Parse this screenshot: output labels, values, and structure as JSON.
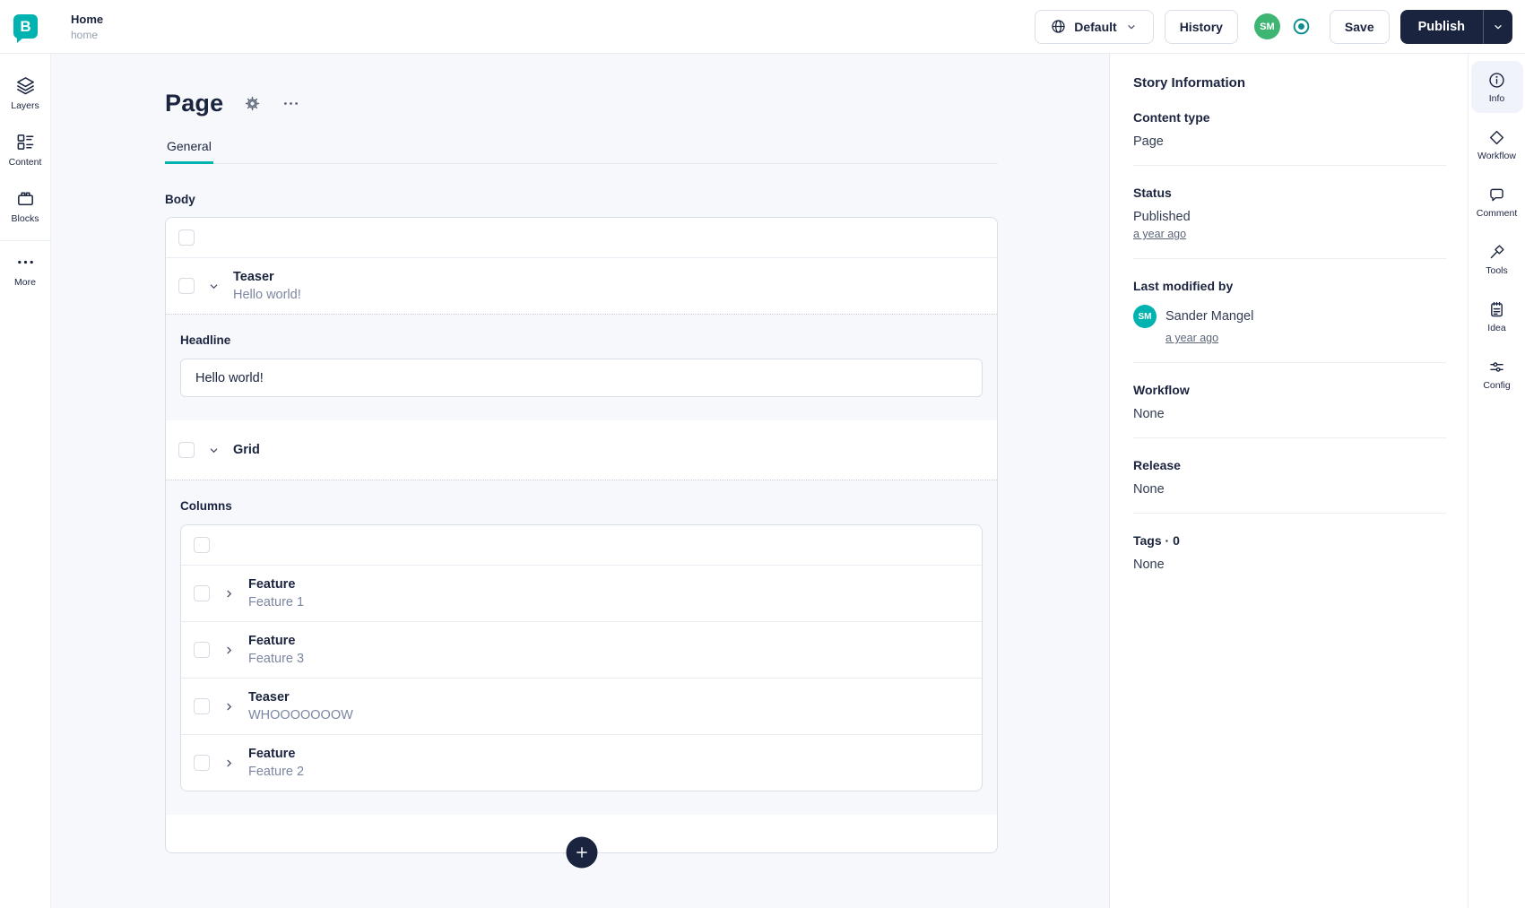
{
  "colors": {
    "brand": "#00b3b0",
    "navy": "#1b243f",
    "avatar_green": "#3fb573",
    "preview_teal": "#0b8f8c"
  },
  "app": {
    "logo_letter": "B"
  },
  "topbar": {
    "breadcrumb": {
      "title": "Home",
      "slug": "home"
    },
    "language_button": "Default",
    "history_button": "History",
    "avatar_initials": "SM",
    "save_button": "Save",
    "publish_button": "Publish"
  },
  "left_sidebar": {
    "items": [
      {
        "label": "Layers",
        "icon": "layers-icon"
      },
      {
        "label": "Content",
        "icon": "content-icon"
      },
      {
        "label": "Blocks",
        "icon": "blocks-icon"
      },
      {
        "label": "More",
        "icon": "more-icon"
      }
    ]
  },
  "editor": {
    "title": "Page",
    "tabs": [
      {
        "label": "General",
        "active": true
      }
    ],
    "body_label": "Body",
    "teaser_block": {
      "type": "Teaser",
      "preview": "Hello world!"
    },
    "headline": {
      "label": "Headline",
      "value": "Hello world!"
    },
    "grid_block": {
      "type": "Grid"
    },
    "columns_label": "Columns",
    "column_blocks": [
      {
        "type": "Feature",
        "preview": "Feature 1"
      },
      {
        "type": "Feature",
        "preview": "Feature 3"
      },
      {
        "type": "Teaser",
        "preview": "WHOOOOOOOW"
      },
      {
        "type": "Feature",
        "preview": "Feature 2"
      }
    ]
  },
  "story_info": {
    "title": "Story Information",
    "content_type": {
      "label": "Content type",
      "value": "Page"
    },
    "status": {
      "label": "Status",
      "value": "Published",
      "time": "a year ago"
    },
    "last_modified": {
      "label": "Last modified by",
      "user": "Sander Mangel",
      "initials": "SM",
      "time": "a year ago"
    },
    "workflow": {
      "label": "Workflow",
      "value": "None"
    },
    "release": {
      "label": "Release",
      "value": "None"
    },
    "tags": {
      "label": "Tags · 0",
      "value": "None"
    }
  },
  "right_toolbar": {
    "items": [
      {
        "label": "Info",
        "icon": "info-icon",
        "active": true
      },
      {
        "label": "Workflow",
        "icon": "workflow-icon"
      },
      {
        "label": "Comment",
        "icon": "comment-icon"
      },
      {
        "label": "Tools",
        "icon": "tools-icon"
      },
      {
        "label": "Idea",
        "icon": "idea-icon"
      },
      {
        "label": "Config",
        "icon": "config-icon"
      }
    ]
  }
}
